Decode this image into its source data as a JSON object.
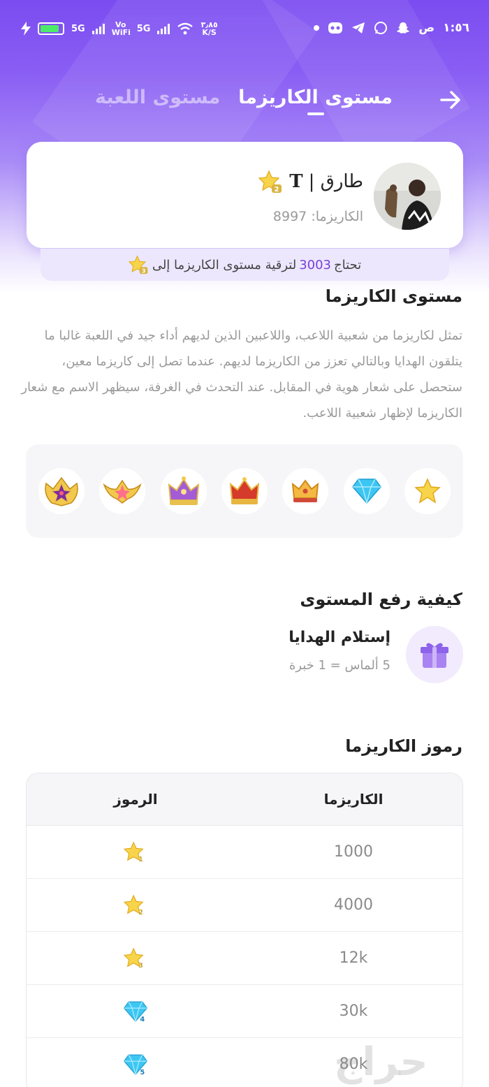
{
  "status_bar": {
    "time": "١:٥٦",
    "ampm": "ص",
    "net1": "5G",
    "net2": "Vo WiFi",
    "net3": "5G",
    "speed_value": "٣٫٨٥",
    "speed_unit": "K/S"
  },
  "header": {
    "tab_active": "مستوى الكاريزما",
    "tab_inactive": "مستوى اللعبة"
  },
  "profile": {
    "name": "طارق |",
    "name_suffix": "T",
    "charisma_label": "الكاريزما: 8997",
    "badge_level": "2"
  },
  "progress": {
    "prefix": "تحتاج",
    "amount": "3003",
    "suffix": "لترقية مستوى الكاريزما إلى",
    "badge_level": "3"
  },
  "charisma_section": {
    "title": "مستوى الكاريزما",
    "description": "تمثل لكاريزما من شعبية اللاعب، واللاعبين الذين لديهم أداء جيد في اللعبة غالبا ما يتلقون الهدايا وبالتالي تعزز من الكاريزما لديهم. عندما تصل إلى كاريزما معين، ستحصل على شعار هوية في المقابل. عند التحدث في الغرفة، سيظهر الاسم مع شعار الكاريزما لإظهار شعبية اللاعب."
  },
  "badges": [
    "star-icon",
    "diamond-icon",
    "crown-gold-icon",
    "crown-red-icon",
    "crown-purple-icon",
    "wing-crest-icon",
    "star-crest-icon"
  ],
  "levelup_section": {
    "title": "كيفية رفع المستوى",
    "item_title": "إستلام الهدايا",
    "item_sub": "5 ألماس = 1 خبرة"
  },
  "symbols_section": {
    "title": "رموز الكاريزما",
    "col_charisma": "الكاريزما",
    "col_symbols": "الرموز",
    "rows": [
      {
        "value": "1000",
        "icon": "star-icon",
        "level": "1"
      },
      {
        "value": "4000",
        "icon": "star-icon",
        "level": "2"
      },
      {
        "value": "12k",
        "icon": "star-icon",
        "level": "3"
      },
      {
        "value": "30k",
        "icon": "diamond-icon",
        "level": "4"
      },
      {
        "value": "80k",
        "icon": "diamond-icon",
        "level": "5"
      }
    ]
  },
  "watermark": "حراج",
  "colors": {
    "accent": "#7b4cf0",
    "progress_number": "#7b3fd9",
    "muted_text": "#9a9a9a"
  }
}
